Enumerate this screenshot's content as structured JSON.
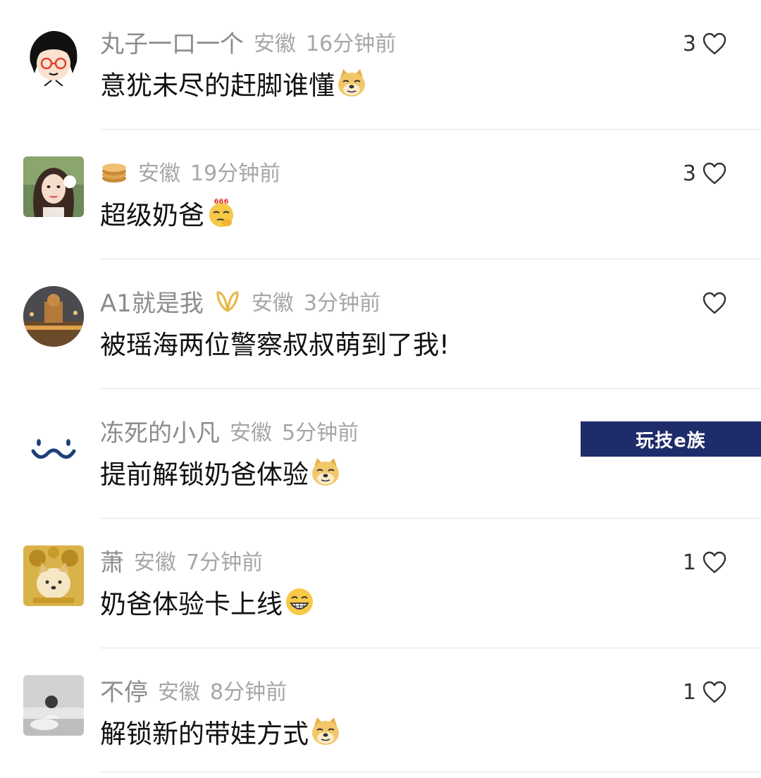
{
  "comments": [
    {
      "username": "丸子一口一个",
      "region": "安徽",
      "time": "16分钟前",
      "text": "意犹未尽的赶脚谁懂",
      "emoji": "doge-icon",
      "likes": "3"
    },
    {
      "username": "",
      "badge": "pancake-badge-icon",
      "region": "安徽",
      "time": "19分钟前",
      "text": "超级奶爸",
      "emoji": "666-thinking-emoji-icon",
      "likes": "3"
    },
    {
      "username": "A1就是我",
      "badge": "golden-ribbon-badge-icon",
      "region": "安徽",
      "time": "3分钟前",
      "text": "被瑶海两位警察叔叔萌到了我!",
      "likes": ""
    },
    {
      "username": "冻死的小凡",
      "region": "安徽",
      "time": "5分钟前",
      "text": "提前解锁奶爸体验",
      "emoji": "doge-icon",
      "likes": ""
    },
    {
      "username": "萧",
      "region": "安徽",
      "time": "7分钟前",
      "text": "奶爸体验卡上线",
      "emoji": "grin-emoji-icon",
      "likes": "1"
    },
    {
      "username": "不停",
      "region": "安徽",
      "time": "8分钟前",
      "text": "解锁新的带娃方式",
      "emoji": "doge-icon",
      "likes": "1"
    }
  ],
  "watermark": {
    "text": "玩技e族"
  },
  "colors": {
    "meta_gray": "#a6a6a6",
    "username_gray": "#8c8c8c",
    "divider": "#e5e5e5",
    "watermark_bg": "#1e2c6b"
  }
}
